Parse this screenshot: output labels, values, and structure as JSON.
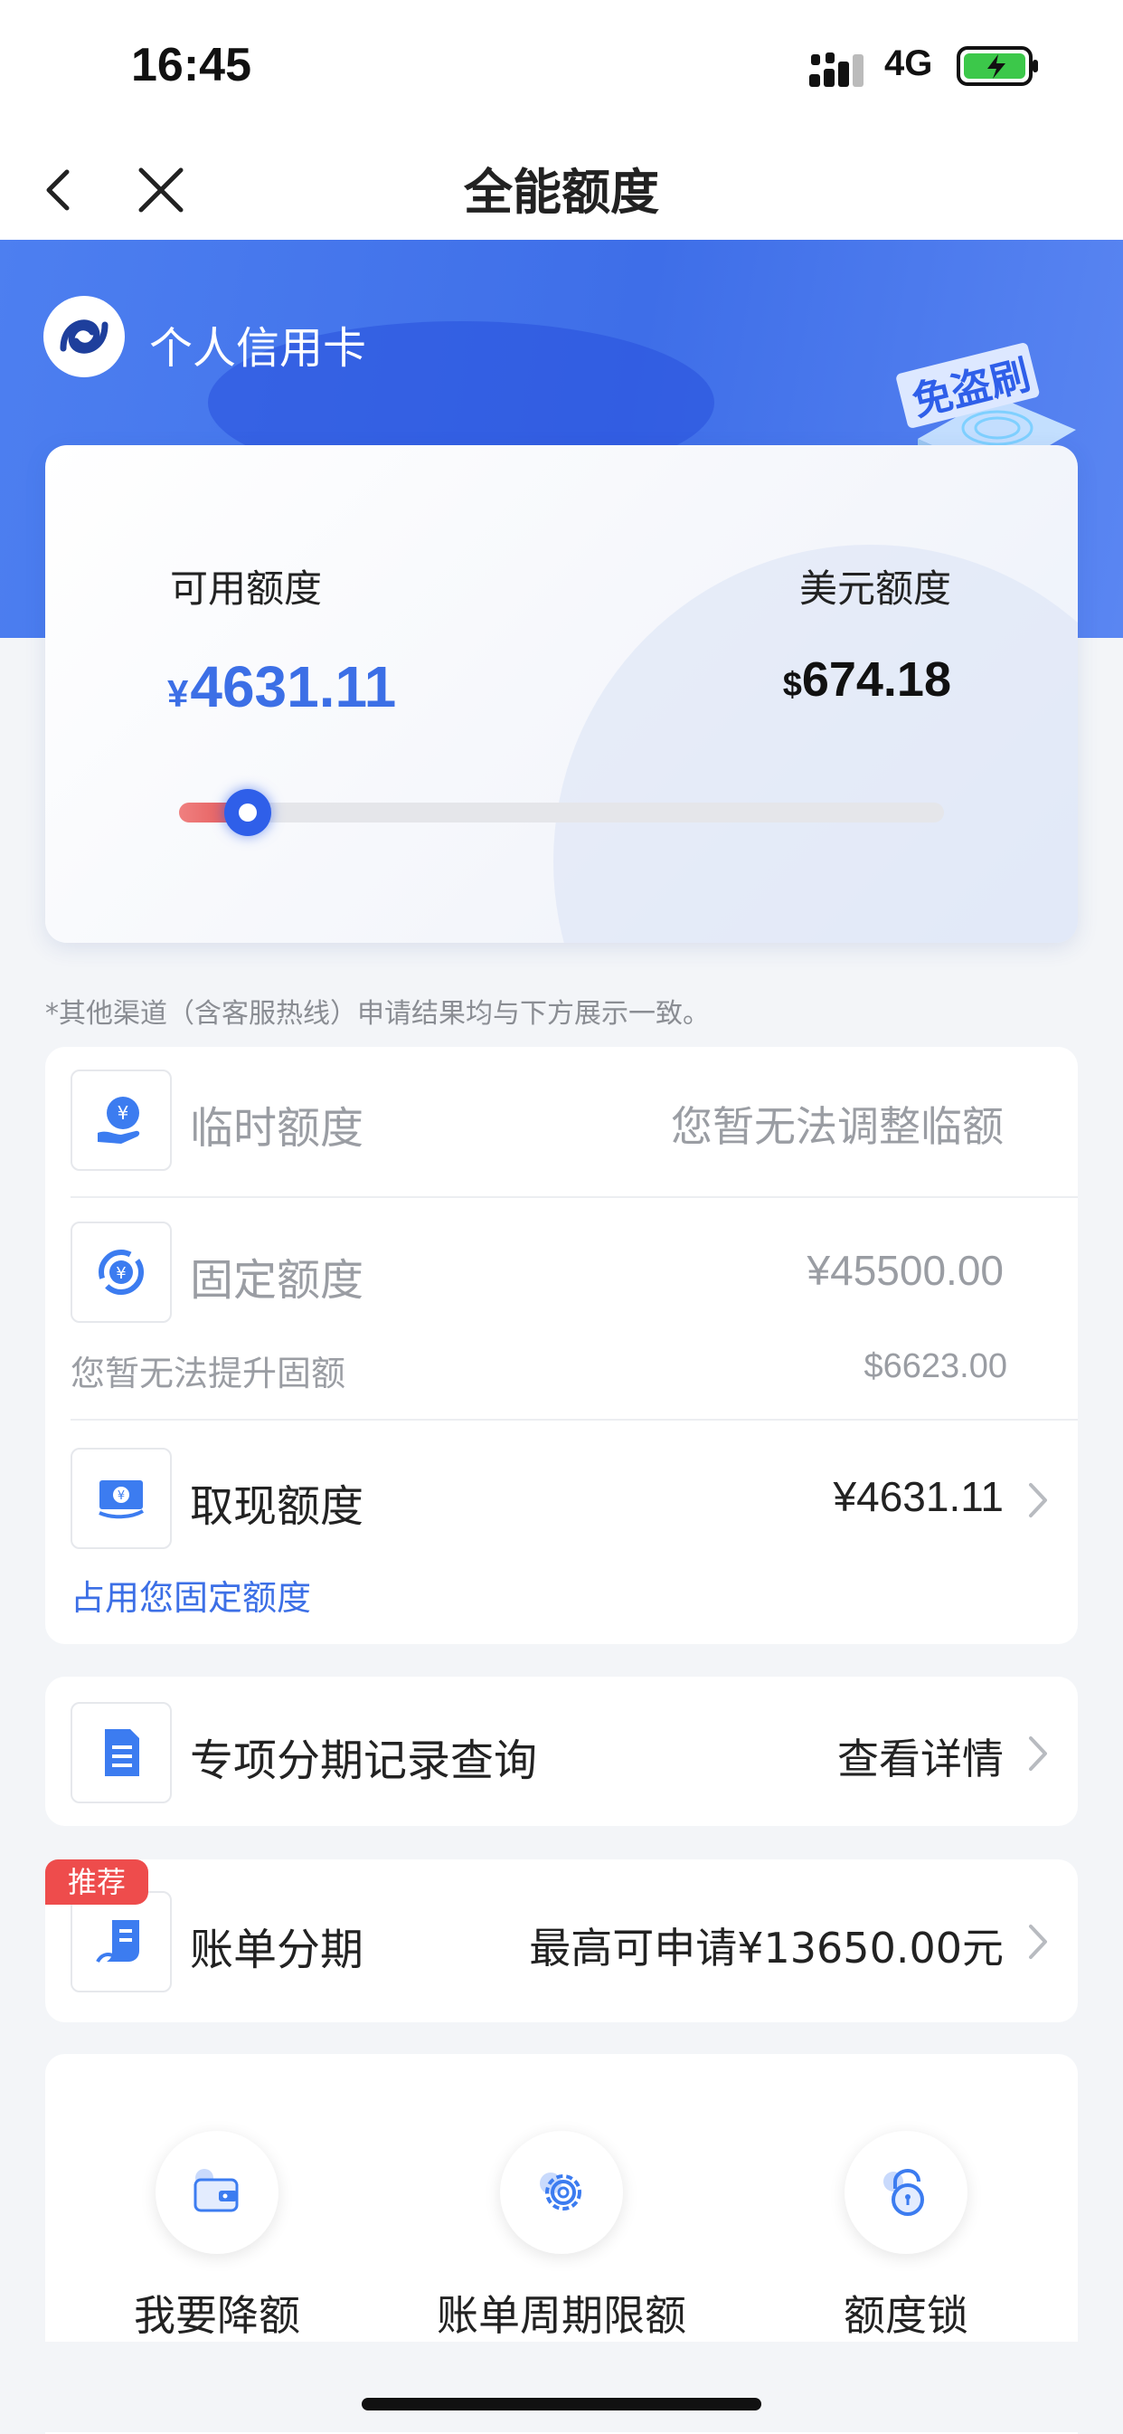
{
  "status_bar": {
    "time": "16:45",
    "network": "4G",
    "battery_icon": "battery-charging-icon",
    "signal_icon": "signal-icon"
  },
  "nav": {
    "title": "全能额度",
    "back_icon": "back-arrow-icon",
    "close_icon": "close-icon"
  },
  "hero": {
    "card_type": "个人信用卡",
    "logo_icon": "bank-logo-icon",
    "badge_text": "免盗刷"
  },
  "limit_card": {
    "available_label": "可用额度",
    "available_currency": "¥",
    "available_amount": "4631.11",
    "usd_label": "美元额度",
    "usd_currency": "$",
    "usd_amount": "674.18",
    "usage_fraction": 0.09
  },
  "disclaimer": "*其他渠道（含客服热线）申请结果均与下方展示一致。",
  "limits": {
    "temporary": {
      "title": "临时额度",
      "value": "您暂无法调整临额",
      "icon": "hand-yen-icon"
    },
    "fixed": {
      "title": "固定额度",
      "value": "¥45500.00",
      "note": "您暂无法提升固额",
      "usd_value": "$6623.00",
      "icon": "yen-cycle-icon"
    },
    "cash": {
      "title": "取现额度",
      "value": "¥4631.11",
      "note": "占用您固定额度",
      "icon": "cash-note-icon"
    }
  },
  "installment_records": {
    "title": "专项分期记录查询",
    "action": "查看详情",
    "icon": "document-list-icon"
  },
  "bill_installment": {
    "tag": "推荐",
    "title": "账单分期",
    "value": "最高可申请¥13650.00元",
    "icon": "bill-installment-icon"
  },
  "quick_actions": [
    {
      "label": "我要降额",
      "icon": "wallet-icon"
    },
    {
      "label": "账单周期限额",
      "icon": "gear-icon"
    },
    {
      "label": "额度锁",
      "icon": "lock-icon"
    }
  ],
  "colors": {
    "accent": "#3c6fe6",
    "hero": "#4d7ff0",
    "tag": "#ee4c4c"
  }
}
